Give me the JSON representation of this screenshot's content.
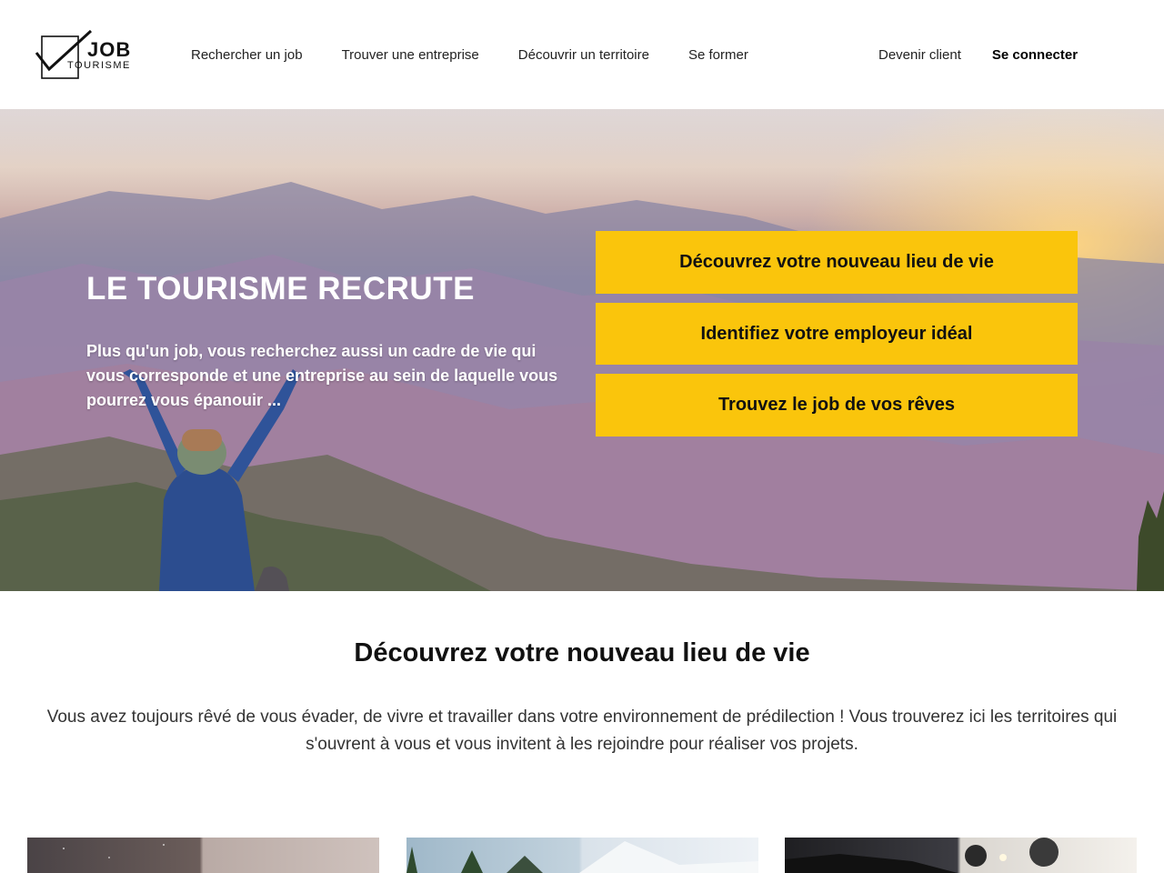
{
  "logo": {
    "word_top": "JOB",
    "word_bottom": "TOURISME"
  },
  "nav": {
    "items": [
      "Rechercher un job",
      "Trouver une entreprise",
      "Découvrir un territoire",
      "Se former"
    ],
    "client": "Devenir client",
    "login": "Se connecter"
  },
  "hero": {
    "title": "LE TOURISME RECRUTE",
    "text": "Plus qu'un job, vous recherchez aussi un cadre de vie qui vous corresponde et une entreprise au sein de laquelle vous pourrez vous épanouir ...",
    "buttons": [
      "Découvrez votre nouveau lieu de vie",
      "Identifiez votre employeur idéal",
      "Trouvez le job de vos rêves"
    ],
    "button_color": "#fac50c"
  },
  "section": {
    "title": "Découvrez votre nouveau lieu de vie",
    "text": "Vous avez toujours rêvé de vous évader, de vivre et travailler dans votre environnement de prédilection ! Vous trouverez ici les territoires qui s'ouvrent à vous et vous invitent à les rejoindre pour réaliser vos projets."
  }
}
